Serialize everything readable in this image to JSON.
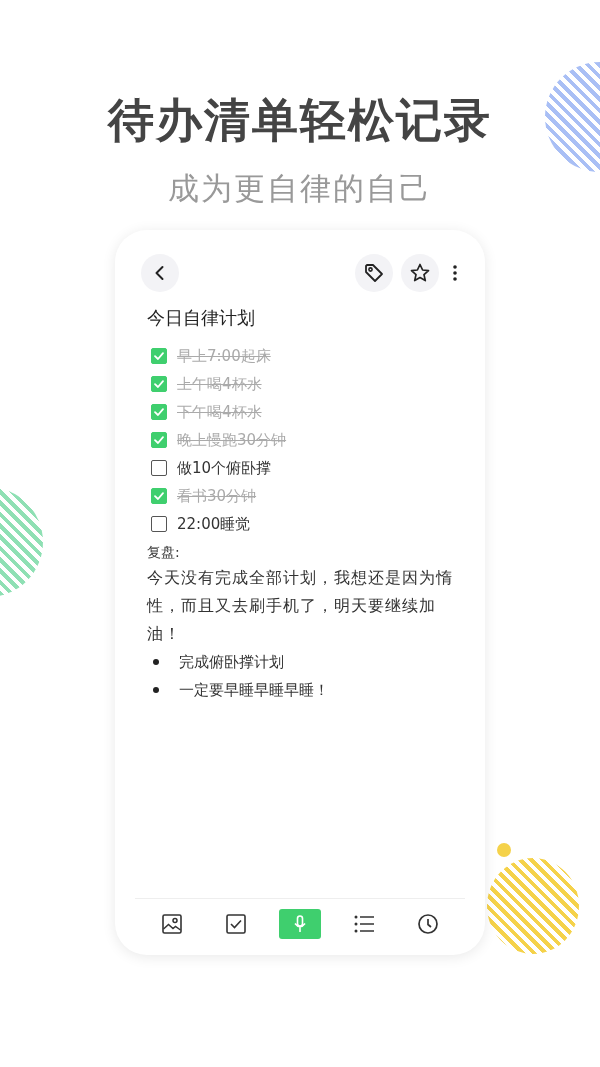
{
  "headline": "待办清单轻松记录",
  "subtitle": "成为更自律的自己",
  "note": {
    "title": "今日自律计划",
    "checklist": [
      {
        "text": "早上7:00起床",
        "checked": true
      },
      {
        "text": "上午喝4杯水",
        "checked": true
      },
      {
        "text": "下午喝4杯水",
        "checked": true
      },
      {
        "text": "晚上慢跑30分钟",
        "checked": true
      },
      {
        "text": "做10个俯卧撑",
        "checked": false
      },
      {
        "text": "看书30分钟",
        "checked": true
      },
      {
        "text": "22:00睡觉",
        "checked": false
      }
    ],
    "label": "复盘:",
    "paragraph": "今天没有完成全部计划，我想还是因为惰性，而且又去刷手机了，明天要继续加油！",
    "bullets": [
      "完成俯卧撑计划",
      "一定要早睡早睡早睡！"
    ]
  },
  "toolbar": [
    {
      "kind": "image",
      "selected": false
    },
    {
      "kind": "checkbox",
      "selected": false
    },
    {
      "kind": "mic",
      "selected": true
    },
    {
      "kind": "list",
      "selected": false
    },
    {
      "kind": "clock",
      "selected": false
    }
  ]
}
